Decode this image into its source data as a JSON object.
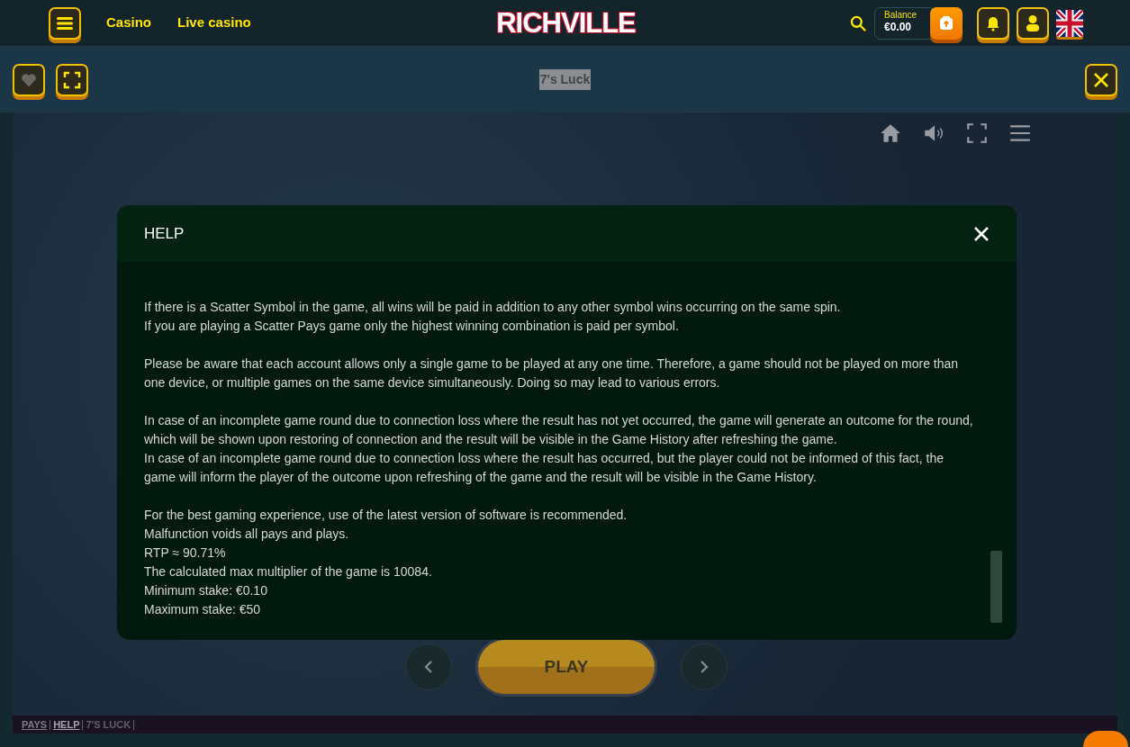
{
  "header": {
    "nav_links": [
      "Casino",
      "Live casino"
    ],
    "logo": "RICHVILLE",
    "balance_label": "Balance",
    "balance_value": "€0.00"
  },
  "game_bar": {
    "title": "7's Luck",
    "favorite": false
  },
  "help_dialog": {
    "title": "HELP",
    "paragraphs": [
      [
        "If there is a Scatter Symbol in the game, all wins will be paid in addition to any other symbol wins occurring on the same spin.",
        "If you are playing a Scatter Pays game only the highest winning combination is paid per symbol."
      ],
      [
        "Please be aware that each account allows only a single game to be played at any one time. Therefore, a game should not be played on more than one device, or multiple games on the same device simultaneously. Doing so may lead to various errors."
      ],
      [
        "In case of an incomplete game round due to connection loss where the result has not yet occurred, the game will generate an outcome for the round, which will be shown upon restoring of connection and the result will be visible in the Game History after refreshing the game.",
        "In case of an incomplete game round due to connection loss where the result has occurred, but the player could not be informed of this fact, the game will inform the player of the outcome upon refreshing of the game and the result will be visible in the Game History."
      ],
      [
        "For the best gaming experience, use of the latest version of software is recommended.",
        "Malfunction voids all pays and plays.",
        "RTP ≈ 90.71%",
        "The calculated max multiplier of the game is 10084.",
        "Minimum stake: €0.10",
        "Maximum stake: €50"
      ]
    ]
  },
  "game_controls": {
    "play": "PLAY"
  },
  "footer_links": [
    {
      "label": "PAYS",
      "kind": "link",
      "selected": false
    },
    {
      "label": "HELP",
      "kind": "link",
      "selected": true
    },
    {
      "label": "7'S LUCK",
      "kind": "text",
      "selected": false
    }
  ]
}
